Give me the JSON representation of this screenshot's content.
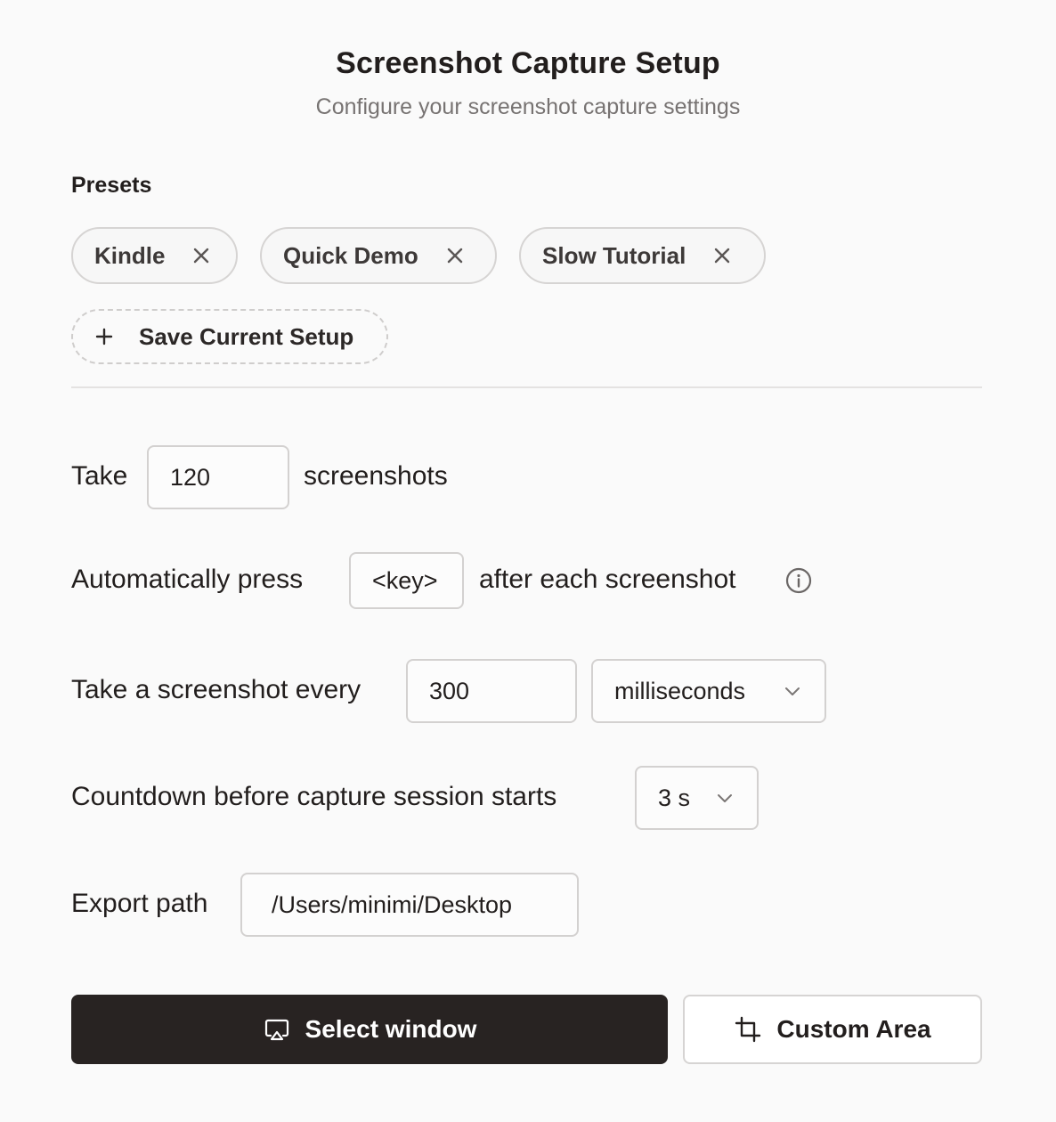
{
  "header": {
    "title": "Screenshot Capture Setup",
    "subtitle": "Configure your screenshot capture settings"
  },
  "presets": {
    "label": "Presets",
    "items": [
      {
        "label": "Kindle"
      },
      {
        "label": "Quick Demo"
      },
      {
        "label": "Slow Tutorial"
      }
    ],
    "save_label": "Save Current Setup"
  },
  "count_row": {
    "prefix": "Take",
    "value": "120",
    "suffix": "screenshots"
  },
  "key_row": {
    "prefix": "Automatically press",
    "key": "<key>",
    "suffix": "after each screenshot"
  },
  "interval_row": {
    "prefix": "Take a screenshot every",
    "value": "300",
    "unit": "milliseconds"
  },
  "countdown_row": {
    "prefix": "Countdown before capture session starts",
    "value": "3 s"
  },
  "export_row": {
    "prefix": "Export path",
    "value": "/Users/minimi/Desktop"
  },
  "actions": {
    "primary": "Select window",
    "secondary": "Custom Area"
  },
  "colors": {
    "background": "#fafafa",
    "primary_button": "#282322",
    "border": "#d6d4d3"
  }
}
